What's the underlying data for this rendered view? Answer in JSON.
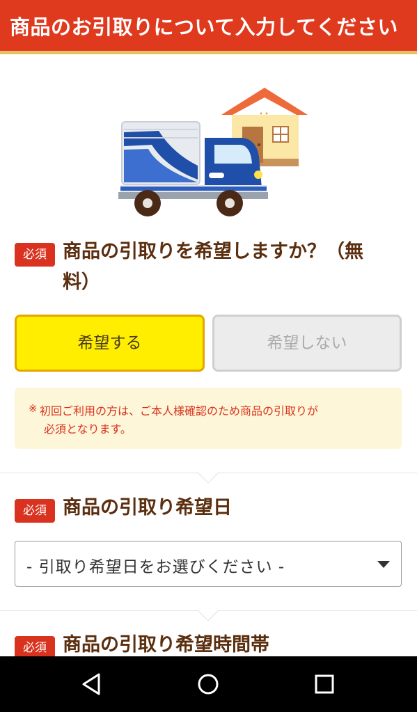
{
  "header": {
    "title": "商品のお引取りについて入力してください"
  },
  "section1": {
    "badge": "必須",
    "question": "商品の引取りを希望しますか？（無料）",
    "question_line1": "商品の引取りを希望しますか？（無",
    "question_line2": "料）",
    "option_yes": "希望する",
    "option_no": "希望しない",
    "selected": "希望する",
    "notice_mark": "※",
    "notice_line1": "初回ご利用の方は、ご本人様確認のため商品の引取りが",
    "notice_line2": "必須となります。"
  },
  "section2": {
    "badge": "必須",
    "question": "商品の引取り希望日",
    "select_value": "- 引取り希望日をお選びください -"
  },
  "section3": {
    "badge": "必須",
    "question": "商品の引取り希望時間帯"
  },
  "navbar": {
    "back": "back-icon",
    "home": "home-icon",
    "recents": "recents-icon"
  },
  "colors": {
    "header": "#e03a1e",
    "required": "#d9331f",
    "selected_button": "#ffee00",
    "title_text": "#5a2e0e"
  }
}
